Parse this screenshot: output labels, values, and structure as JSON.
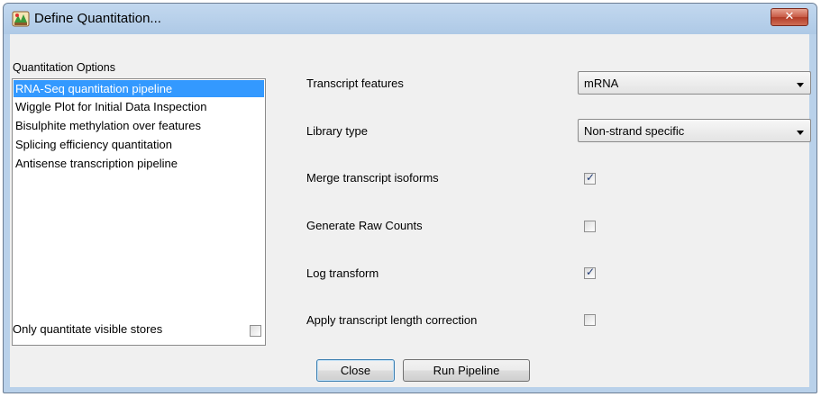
{
  "window": {
    "title": "Define Quantitation...",
    "close_glyph": "✕",
    "app_icon": "seqmonk-app-icon"
  },
  "options": {
    "label": "Quantitation Options",
    "items": [
      {
        "label": "RNA-Seq quantitation pipeline",
        "selected": true
      },
      {
        "label": "Wiggle Plot for Initial Data Inspection",
        "selected": false
      },
      {
        "label": "Bisulphite methylation over features",
        "selected": false
      },
      {
        "label": "Splicing efficiency quantitation",
        "selected": false
      },
      {
        "label": "Antisense transcription pipeline",
        "selected": false
      }
    ],
    "visible_stores_label": "Only quantitate visible stores",
    "visible_stores_checked": false
  },
  "settings": {
    "transcript_features": {
      "label": "Transcript features",
      "value": "mRNA"
    },
    "library_type": {
      "label": "Library type",
      "value": "Non-strand specific"
    },
    "merge_isoforms": {
      "label": "Merge transcript isoforms",
      "checked": true
    },
    "raw_counts": {
      "label": "Generate Raw Counts",
      "checked": false
    },
    "log_transform": {
      "label": "Log transform",
      "checked": true
    },
    "length_correction": {
      "label": "Apply transcript length correction",
      "checked": false
    }
  },
  "buttons": {
    "close": "Close",
    "run": "Run Pipeline"
  },
  "colors": {
    "selection": "#3399ff",
    "title_bar": "#b9d1ea",
    "close_button": "#c75a45",
    "dialog_bg": "#f0f0f0"
  }
}
